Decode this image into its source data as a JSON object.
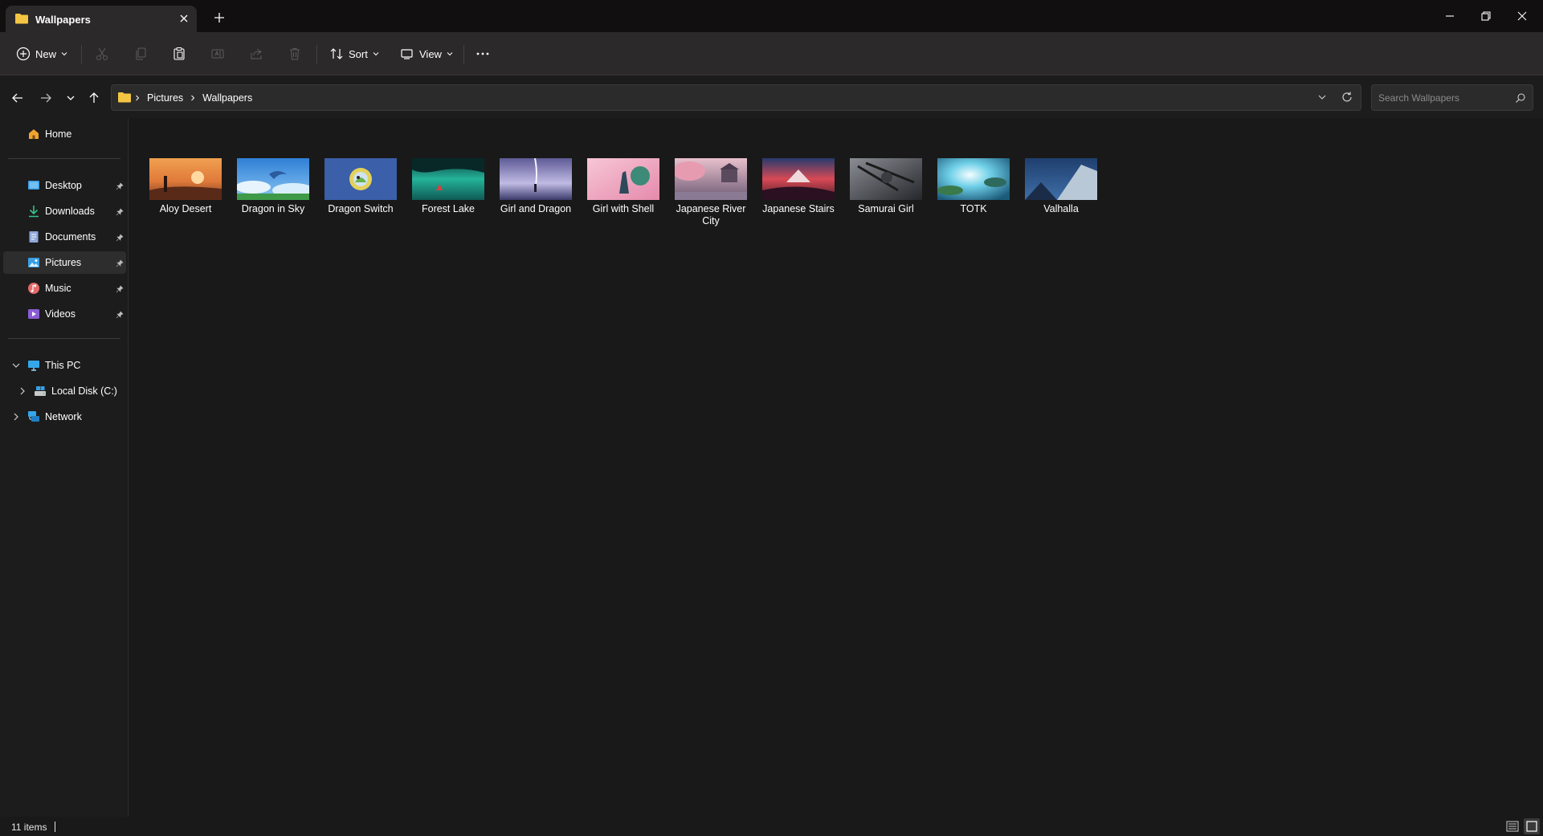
{
  "window": {
    "tab_title": "Wallpapers"
  },
  "toolbar": {
    "new_label": "New",
    "sort_label": "Sort",
    "view_label": "View"
  },
  "address": {
    "crumbs": [
      "Pictures",
      "Wallpapers"
    ]
  },
  "search": {
    "placeholder": "Search Wallpapers"
  },
  "sidebar": {
    "home": "Home",
    "quick_access": [
      {
        "label": "Desktop",
        "icon": "desktop-icon"
      },
      {
        "label": "Downloads",
        "icon": "downloads-icon"
      },
      {
        "label": "Documents",
        "icon": "documents-icon"
      },
      {
        "label": "Pictures",
        "icon": "pictures-icon"
      },
      {
        "label": "Music",
        "icon": "music-icon"
      },
      {
        "label": "Videos",
        "icon": "videos-icon"
      }
    ],
    "this_pc": "This PC",
    "local_disk": "Local Disk (C:)",
    "network": "Network"
  },
  "files": [
    {
      "name": "Aloy Desert",
      "colors": [
        "#e07a3a",
        "#7a3b22"
      ]
    },
    {
      "name": "Dragon in Sky",
      "colors": [
        "#4f9be0",
        "#d9eefc"
      ]
    },
    {
      "name": "Dragon Switch",
      "colors": [
        "#3b5fa8",
        "#e4d15b"
      ]
    },
    {
      "name": "Forest Lake",
      "colors": [
        "#24b39a",
        "#0c3b3b"
      ]
    },
    {
      "name": "Girl and Dragon",
      "colors": [
        "#9d96c9",
        "#3a3a6a"
      ]
    },
    {
      "name": "Girl with Shell",
      "colors": [
        "#f1a9c1",
        "#6a5a8a"
      ]
    },
    {
      "name": "Japanese River City",
      "colors": [
        "#e79bb0",
        "#6b5a74"
      ]
    },
    {
      "name": "Japanese Stairs",
      "colors": [
        "#d84a55",
        "#263a6e"
      ]
    },
    {
      "name": "Samurai Girl",
      "colors": [
        "#6c6f75",
        "#25272c"
      ]
    },
    {
      "name": "TOTK",
      "colors": [
        "#6fd0e8",
        "#2d6a5d"
      ]
    },
    {
      "name": "Valhalla",
      "colors": [
        "#3f6fa8",
        "#b9c8d6"
      ]
    }
  ],
  "status": {
    "item_count": "11 items"
  },
  "colors": {
    "background": "#191919",
    "toolbar": "#2b2929",
    "folder": "#f4c542",
    "accent": "#4ea5e6"
  }
}
